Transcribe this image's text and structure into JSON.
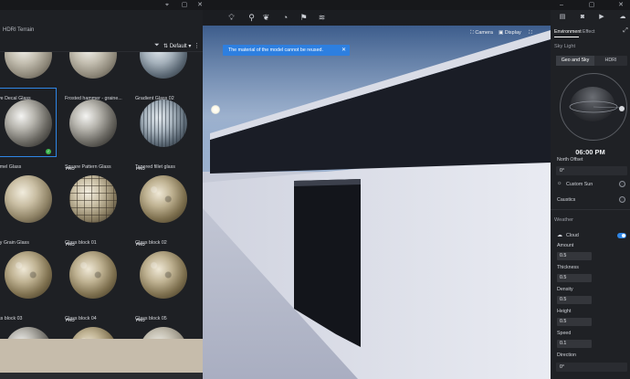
{
  "left_panel": {
    "tabs": [
      "HDRI",
      "Terrain"
    ],
    "sort_label": "Default",
    "materials": [
      {
        "name": "ve Decal Glass",
        "pro": false,
        "style": "frost",
        "selected": false
      },
      {
        "name": "Frosted hammer - graine...",
        "pro": false,
        "style": "frost",
        "selected": false
      },
      {
        "name": "Gradient Glass 02",
        "pro": false,
        "style": "blue",
        "selected": false
      },
      {
        "name": "rmel Glass",
        "pro": false,
        "style": "chrome",
        "selected": true
      },
      {
        "name": "Square Pattern Glass",
        "pro": false,
        "style": "chrome",
        "selected": false
      },
      {
        "name": "Tapered fillet glass",
        "pro": false,
        "style": "stripe",
        "selected": false
      },
      {
        "name": "ry Grain Glass",
        "pro": false,
        "style": "stone",
        "selected": false
      },
      {
        "name": "Glass block 01",
        "pro": true,
        "style": "tile",
        "selected": false
      },
      {
        "name": "Glass block 02",
        "pro": true,
        "style": "bumpy",
        "selected": false
      },
      {
        "name": "ss block 03",
        "pro": false,
        "style": "bumpy",
        "selected": false
      },
      {
        "name": "Glass block 04",
        "pro": true,
        "style": "bumpy",
        "selected": false
      },
      {
        "name": "Glass block 05",
        "pro": true,
        "style": "bumpy",
        "selected": false
      },
      {
        "name": "",
        "pro": false,
        "style": "chrome",
        "selected": false
      },
      {
        "name": "",
        "pro": true,
        "style": "bumpy",
        "selected": false
      },
      {
        "name": "",
        "pro": true,
        "style": "frost",
        "selected": false
      }
    ]
  },
  "viewport": {
    "camera_label": "Camera",
    "display_label": "Display",
    "toast": "The material of the model cannot be reused."
  },
  "right_panel": {
    "tabs": [
      "Environment",
      "Effect"
    ],
    "sky_light_title": "Sky Light",
    "sky_modes": [
      "Geo and Sky",
      "HDRI"
    ],
    "time": "06:00 PM",
    "north_offset_label": "North Offset",
    "north_offset_value": "0°",
    "custom_sun_label": "Custom Sun",
    "caustics_label": "Caustics",
    "weather_title": "Weather",
    "cloud_label": "Cloud",
    "amount_label": "Amount",
    "amount_value": "0.5",
    "thickness_label": "Thickness",
    "thickness_value": "0.5",
    "density_label": "Density",
    "density_value": "0.5",
    "height_label": "Height",
    "height_value": "0.5",
    "speed_label": "Speed",
    "speed_value": "0.1",
    "direction_label": "Direction",
    "direction_value": "0°"
  },
  "colors": {
    "accent": "#2f86e6",
    "success": "#3fb950",
    "panel_bg": "#1e2024"
  },
  "icons": {
    "toolbar": [
      "lightbulb-icon",
      "pin-icon",
      "leaf-icon",
      "apple-icon",
      "flag-icon",
      "layers-icon"
    ],
    "right_top": [
      "file-icon",
      "camera-icon",
      "video-icon",
      "cloud-icon",
      "rotate-icon",
      "expand-icon"
    ]
  }
}
